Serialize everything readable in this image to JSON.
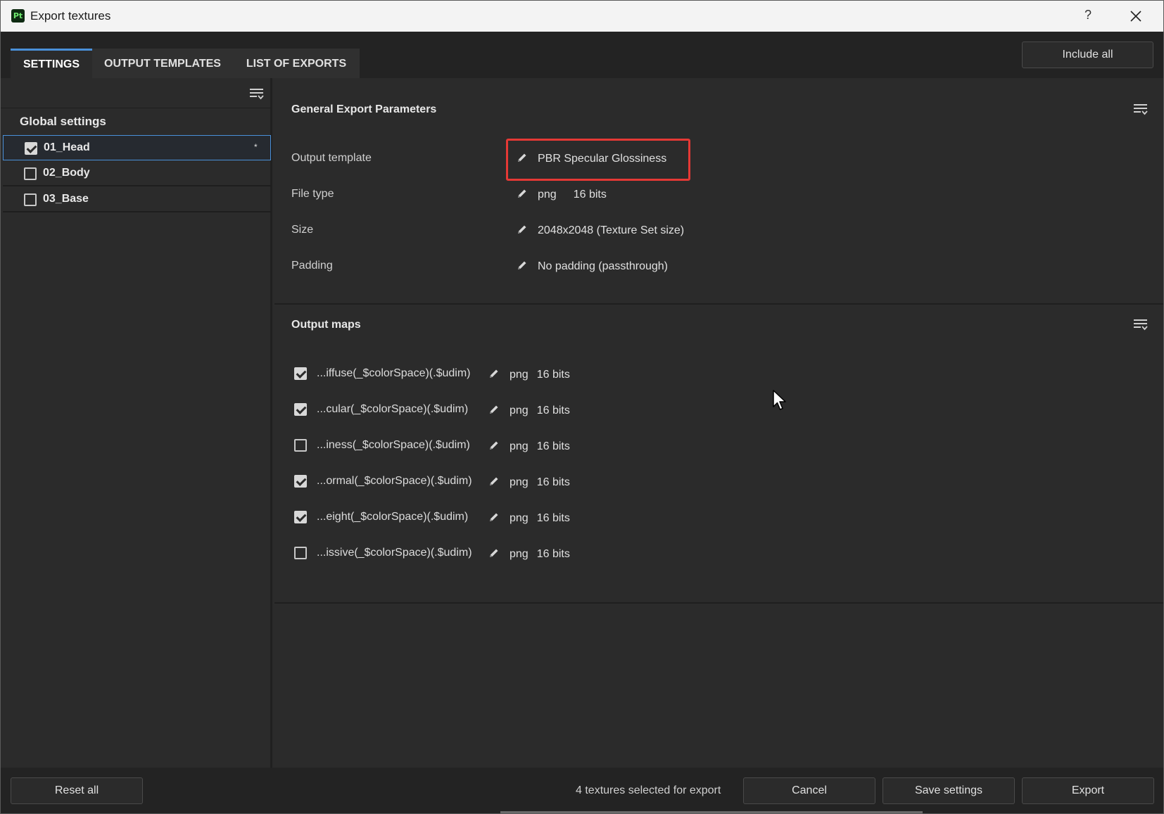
{
  "window": {
    "title": "Export textures",
    "app_icon_text": "Pt",
    "help_label": "?"
  },
  "tabs": [
    {
      "label": "SETTINGS",
      "active": true
    },
    {
      "label": "OUTPUT TEMPLATES",
      "active": false
    },
    {
      "label": "LIST OF EXPORTS",
      "active": false
    }
  ],
  "toolbar": {
    "include_all_label": "Include all"
  },
  "sidebar": {
    "global_settings_label": "Global settings",
    "texture_sets": [
      {
        "label": "01_Head",
        "checked": true,
        "selected": true,
        "modified_marker": "*"
      },
      {
        "label": "02_Body",
        "checked": false,
        "selected": false
      },
      {
        "label": "03_Base",
        "checked": false,
        "selected": false
      }
    ]
  },
  "general": {
    "title": "General Export Parameters",
    "params": [
      {
        "label": "Output template",
        "value": "PBR Specular Glossiness"
      },
      {
        "label": "File type",
        "value": "png",
        "value2": "16 bits"
      },
      {
        "label": "Size",
        "value": "2048x2048 (Texture Set size)"
      },
      {
        "label": "Padding",
        "value": "No padding (passthrough)"
      }
    ]
  },
  "output_maps": {
    "title": "Output maps",
    "maps": [
      {
        "name": "...iffuse(_$colorSpace)(.$udim)",
        "format": "png",
        "bits": "16 bits",
        "checked": true
      },
      {
        "name": "...cular(_$colorSpace)(.$udim)",
        "format": "png",
        "bits": "16 bits",
        "checked": true
      },
      {
        "name": "...iness(_$colorSpace)(.$udim)",
        "format": "png",
        "bits": "16 bits",
        "checked": false
      },
      {
        "name": "...ormal(_$colorSpace)(.$udim)",
        "format": "png",
        "bits": "16 bits",
        "checked": true
      },
      {
        "name": "...eight(_$colorSpace)(.$udim)",
        "format": "png",
        "bits": "16 bits",
        "checked": true
      },
      {
        "name": "...issive(_$colorSpace)(.$udim)",
        "format": "png",
        "bits": "16 bits",
        "checked": false
      }
    ]
  },
  "footer": {
    "reset_label": "Reset all",
    "status": "4 textures selected for export",
    "cancel_label": "Cancel",
    "save_label": "Save settings",
    "export_label": "Export"
  },
  "colors": {
    "background": "#2b2b2b",
    "accent": "#4a90d9",
    "highlight": "#e53935"
  }
}
